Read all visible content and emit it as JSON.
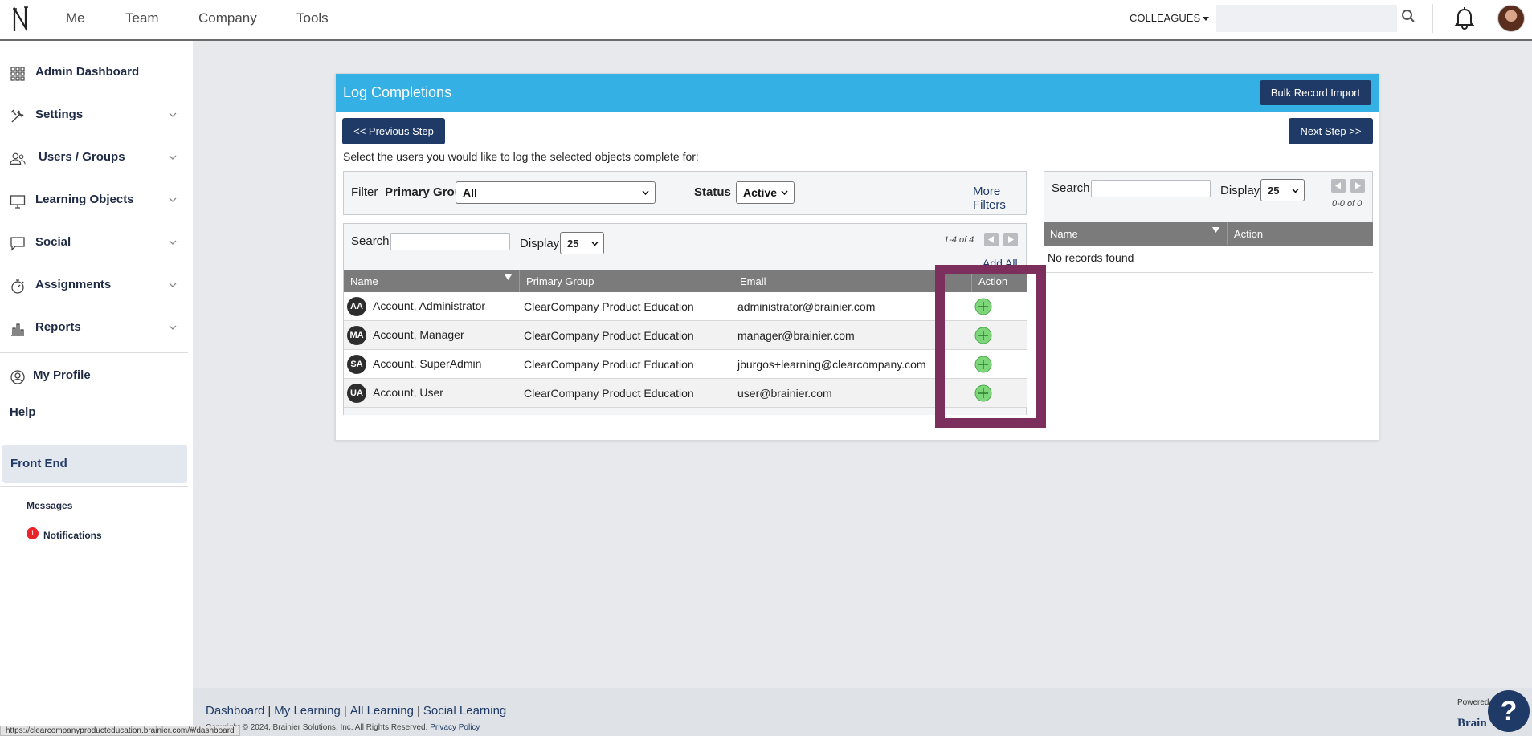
{
  "topbar": {
    "nav": [
      "Me",
      "Team",
      "Company",
      "Tools"
    ],
    "colleagues_label": "COLLEAGUES",
    "search_placeholder": ""
  },
  "sidebar": {
    "items": [
      {
        "label": "Admin Dashboard",
        "icon": "grid-icon",
        "expandable": false
      },
      {
        "label": "Settings",
        "icon": "tools-icon",
        "expandable": true
      },
      {
        "label": "Users / Groups",
        "icon": "users-icon",
        "expandable": true
      },
      {
        "label": "Learning Objects",
        "icon": "monitor-icon",
        "expandable": true
      },
      {
        "label": "Social",
        "icon": "chat-icon",
        "expandable": true
      },
      {
        "label": "Assignments",
        "icon": "stopwatch-icon",
        "expandable": true
      },
      {
        "label": "Reports",
        "icon": "bar-chart-icon",
        "expandable": true
      }
    ],
    "my_profile": "My Profile",
    "help": "Help",
    "front_end": "Front End",
    "messages": "Messages",
    "notifications": "Notifications",
    "notification_count": "1"
  },
  "panel": {
    "title": "Log Completions",
    "bulk_import": "Bulk Record Import",
    "prev_step": "<< Previous Step",
    "next_step": "Next Step >>",
    "intro": "Select the users you would like to log the selected objects complete for:",
    "filter": {
      "filter_label": "Filter",
      "primary_group_label": "Primary Group",
      "primary_group_value": "All",
      "status_label": "Status",
      "status_value": "Active",
      "more_filters": "More Filters"
    },
    "list": {
      "search_label": "Search",
      "display_label": "Display",
      "display_value": "25",
      "pager": "1-4 of 4",
      "add_all": "Add All",
      "columns": [
        "Name",
        "Primary Group",
        "Email",
        "",
        "Action"
      ],
      "rows": [
        {
          "initials": "AA",
          "name": "Account, Administrator",
          "group": "ClearCompany Product Education",
          "email": "administrator@brainier.com"
        },
        {
          "initials": "MA",
          "name": "Account, Manager",
          "group": "ClearCompany Product Education",
          "email": "manager@brainier.com"
        },
        {
          "initials": "SA",
          "name": "Account, SuperAdmin",
          "group": "ClearCompany Product Education",
          "email": "jburgos+learning@clearcompany.com"
        },
        {
          "initials": "UA",
          "name": "Account, User",
          "group": "ClearCompany Product Education",
          "email": "user@brainier.com"
        }
      ]
    },
    "selected": {
      "search_label": "Search",
      "display_label": "Display",
      "display_value": "25",
      "pager": "0-0 of 0",
      "columns": [
        "Name",
        "Action"
      ],
      "empty_text": "No records found"
    }
  },
  "footer": {
    "links": [
      "Dashboard",
      "My Learning",
      "All Learning",
      "Social Learning"
    ],
    "copyright": "Copyright © 2024, Brainier Solutions, Inc. All Rights Reserved.",
    "privacy": "Privacy Policy",
    "status_url": "https://clearcompanyproducteducation.brainier.com/#/dashboard",
    "powered": "Powered",
    "brand": "Brain",
    "help_bubble": "?"
  },
  "colors": {
    "header_blue": "#35b0e4",
    "navy": "#1f3a66",
    "highlight": "#7c2f5d",
    "add_green": "#7ed67a",
    "notification_red": "#e8232a"
  }
}
